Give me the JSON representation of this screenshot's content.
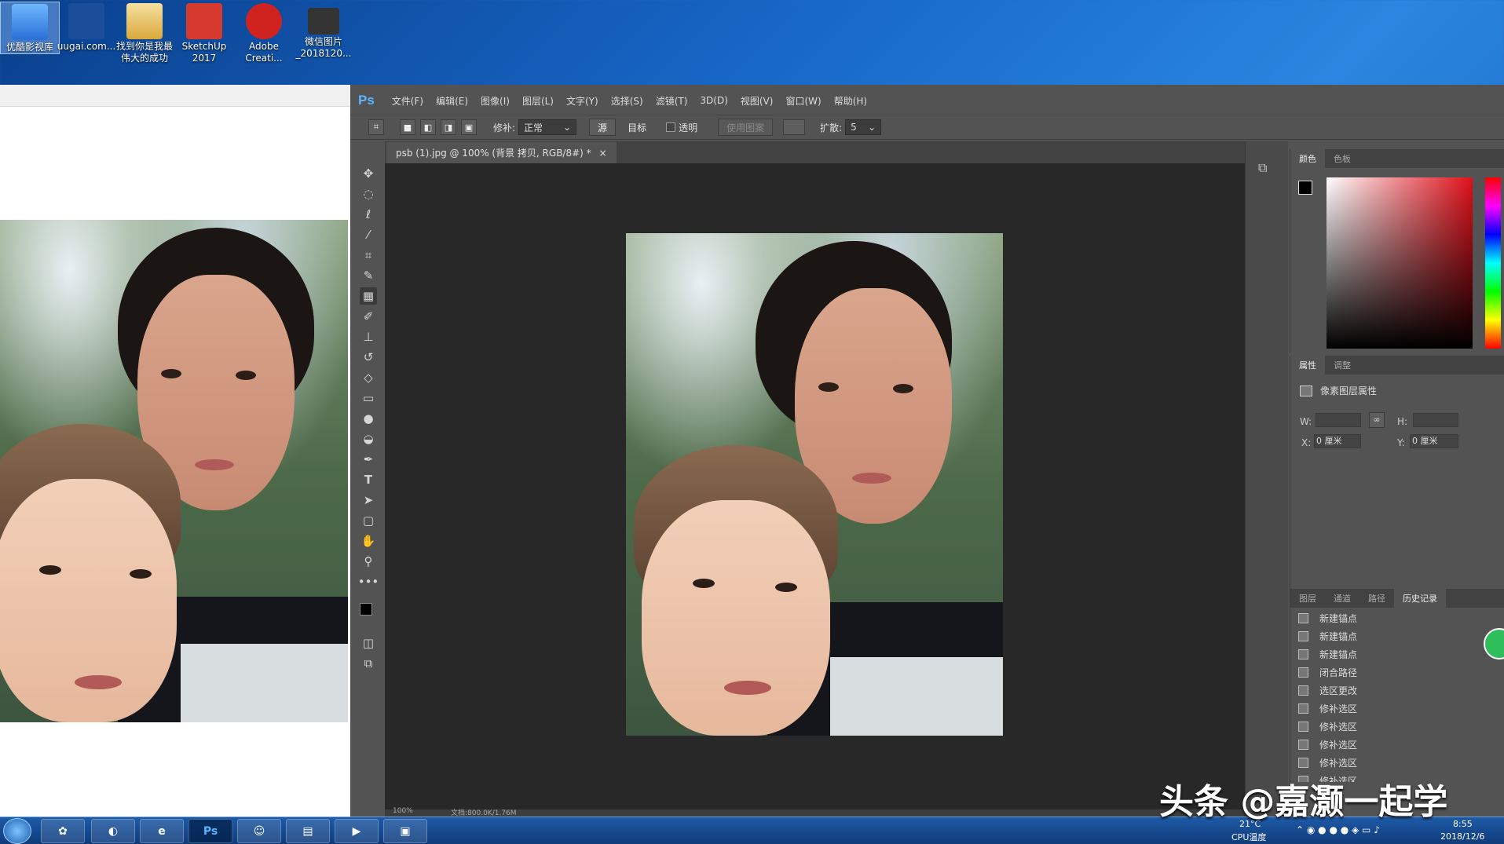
{
  "desktop": {
    "icons": [
      {
        "label": "优酷影视库",
        "icon": "youku-icon",
        "color": "#3a8ee6",
        "selected": true
      },
      {
        "label": "uugai.com...",
        "icon": "web-shortcut-icon",
        "color": "#1b4e9a"
      },
      {
        "label": "找到你是我最伟大的成功",
        "icon": "folder-icon",
        "color": "#e9c46a"
      },
      {
        "label": "SketchUp 2017",
        "icon": "sketchup-icon",
        "color": "#d63a2f"
      },
      {
        "label": "Adobe Creati...",
        "icon": "adobe-cc-icon",
        "color": "#d0231f"
      },
      {
        "label": "微信图片_2018120...",
        "icon": "image-file-icon",
        "color": "#333333"
      }
    ]
  },
  "photoshop": {
    "logo": "Ps",
    "menu": [
      "文件(F)",
      "编辑(E)",
      "图像(I)",
      "图层(L)",
      "文字(Y)",
      "选择(S)",
      "滤镜(T)",
      "3D(D)",
      "视图(V)",
      "窗口(W)",
      "帮助(H)"
    ],
    "options": {
      "patch_label": "修补:",
      "patch_mode": "正常",
      "source_btn": "源",
      "target_btn": "目标",
      "transparent_label": "透明",
      "use_pattern_btn": "使用图案",
      "diffusion_label": "扩散:",
      "diffusion_value": "5"
    },
    "document_tab": "psb (1).jpg @ 100% (背景 拷贝, RGB/8#) *",
    "status": {
      "zoom": "100%",
      "doc": "文档:800.0K/1.76M"
    },
    "panels": {
      "color_tabs": [
        "颜色",
        "色板"
      ],
      "props_tabs": [
        "属性",
        "调整"
      ],
      "props_title": "像素图层属性",
      "w_label": "W:",
      "h_label": "H:",
      "x_label": "X:",
      "x_value": "0 厘米",
      "y_label": "Y:",
      "y_value": "0 厘米",
      "bottom_tabs": [
        "图层",
        "通道",
        "路径",
        "历史记录"
      ],
      "history": [
        "新建锚点",
        "新建锚点",
        "新建锚点",
        "闭合路径",
        "选区更改",
        "修补选区",
        "修补选区",
        "修补选区",
        "修补选区",
        "修补选区"
      ]
    }
  },
  "taskbar": {
    "temperature": "21°C",
    "cpu_label": "CPU温度",
    "time": "8:55",
    "date": "2018/12/6",
    "apps": [
      "start-orb-icon",
      "colorful-app-icon",
      "browser-icon",
      "ie-icon",
      "photoshop-icon",
      "wechat-icon",
      "explorer-icon",
      "media-icon",
      "picture-viewer-icon"
    ],
    "ps_label": "Ps"
  },
  "watermark": "头条 @嘉灏一起学"
}
